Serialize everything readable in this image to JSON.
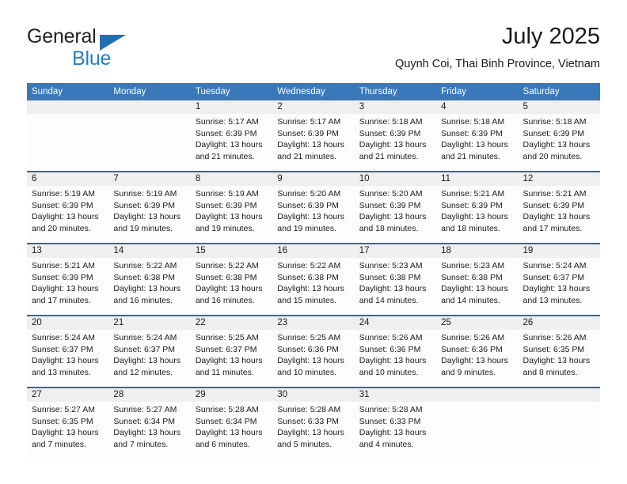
{
  "brand": {
    "name_part1": "General",
    "name_part2": "Blue",
    "triangle_color": "#1f6fb5",
    "blue_color": "#2380c6"
  },
  "header": {
    "title": "July 2025",
    "subtitle": "Quynh Coi, Thai Binh Province, Vietnam",
    "header_bg_color": "#3a78b9",
    "row_divider_color": "#2b6aad",
    "daynum_bg_color": "#efefef"
  },
  "weekday_headers": [
    "Sunday",
    "Monday",
    "Tuesday",
    "Wednesday",
    "Thursday",
    "Friday",
    "Saturday"
  ],
  "weeks": [
    [
      {
        "day": "",
        "sunrise": "",
        "sunset": "",
        "daylight_line1": "",
        "daylight_line2": "",
        "empty": true
      },
      {
        "day": "",
        "sunrise": "",
        "sunset": "",
        "daylight_line1": "",
        "daylight_line2": "",
        "empty": true
      },
      {
        "day": "1",
        "sunrise": "Sunrise: 5:17 AM",
        "sunset": "Sunset: 6:39 PM",
        "daylight_line1": "Daylight: 13 hours",
        "daylight_line2": "and 21 minutes."
      },
      {
        "day": "2",
        "sunrise": "Sunrise: 5:17 AM",
        "sunset": "Sunset: 6:39 PM",
        "daylight_line1": "Daylight: 13 hours",
        "daylight_line2": "and 21 minutes."
      },
      {
        "day": "3",
        "sunrise": "Sunrise: 5:18 AM",
        "sunset": "Sunset: 6:39 PM",
        "daylight_line1": "Daylight: 13 hours",
        "daylight_line2": "and 21 minutes."
      },
      {
        "day": "4",
        "sunrise": "Sunrise: 5:18 AM",
        "sunset": "Sunset: 6:39 PM",
        "daylight_line1": "Daylight: 13 hours",
        "daylight_line2": "and 21 minutes."
      },
      {
        "day": "5",
        "sunrise": "Sunrise: 5:18 AM",
        "sunset": "Sunset: 6:39 PM",
        "daylight_line1": "Daylight: 13 hours",
        "daylight_line2": "and 20 minutes."
      }
    ],
    [
      {
        "day": "6",
        "sunrise": "Sunrise: 5:19 AM",
        "sunset": "Sunset: 6:39 PM",
        "daylight_line1": "Daylight: 13 hours",
        "daylight_line2": "and 20 minutes."
      },
      {
        "day": "7",
        "sunrise": "Sunrise: 5:19 AM",
        "sunset": "Sunset: 6:39 PM",
        "daylight_line1": "Daylight: 13 hours",
        "daylight_line2": "and 19 minutes."
      },
      {
        "day": "8",
        "sunrise": "Sunrise: 5:19 AM",
        "sunset": "Sunset: 6:39 PM",
        "daylight_line1": "Daylight: 13 hours",
        "daylight_line2": "and 19 minutes."
      },
      {
        "day": "9",
        "sunrise": "Sunrise: 5:20 AM",
        "sunset": "Sunset: 6:39 PM",
        "daylight_line1": "Daylight: 13 hours",
        "daylight_line2": "and 19 minutes."
      },
      {
        "day": "10",
        "sunrise": "Sunrise: 5:20 AM",
        "sunset": "Sunset: 6:39 PM",
        "daylight_line1": "Daylight: 13 hours",
        "daylight_line2": "and 18 minutes."
      },
      {
        "day": "11",
        "sunrise": "Sunrise: 5:21 AM",
        "sunset": "Sunset: 6:39 PM",
        "daylight_line1": "Daylight: 13 hours",
        "daylight_line2": "and 18 minutes."
      },
      {
        "day": "12",
        "sunrise": "Sunrise: 5:21 AM",
        "sunset": "Sunset: 6:39 PM",
        "daylight_line1": "Daylight: 13 hours",
        "daylight_line2": "and 17 minutes."
      }
    ],
    [
      {
        "day": "13",
        "sunrise": "Sunrise: 5:21 AM",
        "sunset": "Sunset: 6:39 PM",
        "daylight_line1": "Daylight: 13 hours",
        "daylight_line2": "and 17 minutes."
      },
      {
        "day": "14",
        "sunrise": "Sunrise: 5:22 AM",
        "sunset": "Sunset: 6:38 PM",
        "daylight_line1": "Daylight: 13 hours",
        "daylight_line2": "and 16 minutes."
      },
      {
        "day": "15",
        "sunrise": "Sunrise: 5:22 AM",
        "sunset": "Sunset: 6:38 PM",
        "daylight_line1": "Daylight: 13 hours",
        "daylight_line2": "and 16 minutes."
      },
      {
        "day": "16",
        "sunrise": "Sunrise: 5:22 AM",
        "sunset": "Sunset: 6:38 PM",
        "daylight_line1": "Daylight: 13 hours",
        "daylight_line2": "and 15 minutes."
      },
      {
        "day": "17",
        "sunrise": "Sunrise: 5:23 AM",
        "sunset": "Sunset: 6:38 PM",
        "daylight_line1": "Daylight: 13 hours",
        "daylight_line2": "and 14 minutes."
      },
      {
        "day": "18",
        "sunrise": "Sunrise: 5:23 AM",
        "sunset": "Sunset: 6:38 PM",
        "daylight_line1": "Daylight: 13 hours",
        "daylight_line2": "and 14 minutes."
      },
      {
        "day": "19",
        "sunrise": "Sunrise: 5:24 AM",
        "sunset": "Sunset: 6:37 PM",
        "daylight_line1": "Daylight: 13 hours",
        "daylight_line2": "and 13 minutes."
      }
    ],
    [
      {
        "day": "20",
        "sunrise": "Sunrise: 5:24 AM",
        "sunset": "Sunset: 6:37 PM",
        "daylight_line1": "Daylight: 13 hours",
        "daylight_line2": "and 13 minutes."
      },
      {
        "day": "21",
        "sunrise": "Sunrise: 5:24 AM",
        "sunset": "Sunset: 6:37 PM",
        "daylight_line1": "Daylight: 13 hours",
        "daylight_line2": "and 12 minutes."
      },
      {
        "day": "22",
        "sunrise": "Sunrise: 5:25 AM",
        "sunset": "Sunset: 6:37 PM",
        "daylight_line1": "Daylight: 13 hours",
        "daylight_line2": "and 11 minutes."
      },
      {
        "day": "23",
        "sunrise": "Sunrise: 5:25 AM",
        "sunset": "Sunset: 6:36 PM",
        "daylight_line1": "Daylight: 13 hours",
        "daylight_line2": "and 10 minutes."
      },
      {
        "day": "24",
        "sunrise": "Sunrise: 5:26 AM",
        "sunset": "Sunset: 6:36 PM",
        "daylight_line1": "Daylight: 13 hours",
        "daylight_line2": "and 10 minutes."
      },
      {
        "day": "25",
        "sunrise": "Sunrise: 5:26 AM",
        "sunset": "Sunset: 6:36 PM",
        "daylight_line1": "Daylight: 13 hours",
        "daylight_line2": "and 9 minutes."
      },
      {
        "day": "26",
        "sunrise": "Sunrise: 5:26 AM",
        "sunset": "Sunset: 6:35 PM",
        "daylight_line1": "Daylight: 13 hours",
        "daylight_line2": "and 8 minutes."
      }
    ],
    [
      {
        "day": "27",
        "sunrise": "Sunrise: 5:27 AM",
        "sunset": "Sunset: 6:35 PM",
        "daylight_line1": "Daylight: 13 hours",
        "daylight_line2": "and 7 minutes."
      },
      {
        "day": "28",
        "sunrise": "Sunrise: 5:27 AM",
        "sunset": "Sunset: 6:34 PM",
        "daylight_line1": "Daylight: 13 hours",
        "daylight_line2": "and 7 minutes."
      },
      {
        "day": "29",
        "sunrise": "Sunrise: 5:28 AM",
        "sunset": "Sunset: 6:34 PM",
        "daylight_line1": "Daylight: 13 hours",
        "daylight_line2": "and 6 minutes."
      },
      {
        "day": "30",
        "sunrise": "Sunrise: 5:28 AM",
        "sunset": "Sunset: 6:33 PM",
        "daylight_line1": "Daylight: 13 hours",
        "daylight_line2": "and 5 minutes."
      },
      {
        "day": "31",
        "sunrise": "Sunrise: 5:28 AM",
        "sunset": "Sunset: 6:33 PM",
        "daylight_line1": "Daylight: 13 hours",
        "daylight_line2": "and 4 minutes."
      },
      {
        "day": "",
        "sunrise": "",
        "sunset": "",
        "daylight_line1": "",
        "daylight_line2": "",
        "empty": true
      },
      {
        "day": "",
        "sunrise": "",
        "sunset": "",
        "daylight_line1": "",
        "daylight_line2": "",
        "empty": true
      }
    ]
  ]
}
